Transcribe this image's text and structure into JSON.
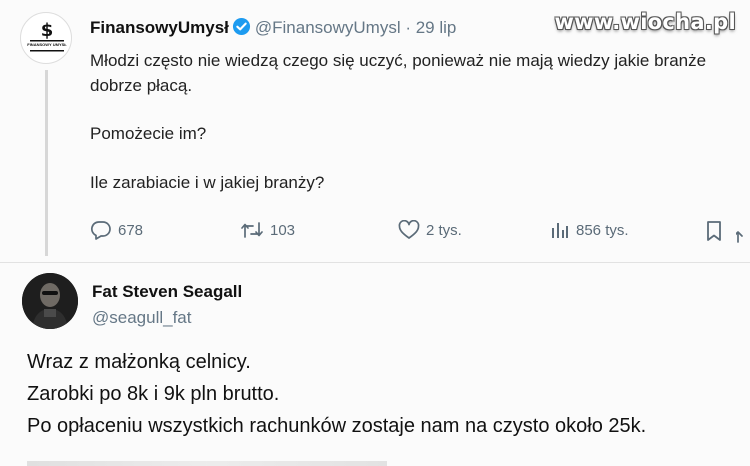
{
  "watermark": "www.wiocha.pl",
  "tweet": {
    "author_name": "FinansowyUmysł",
    "handle": "@FinansowyUmysl",
    "date": "· 29 lip",
    "avatar_text": "FINANSOWY UMYSŁ",
    "body": [
      "Młodzi często nie wiedzą czego się uczyć, ponieważ nie mają wiedzy jakie branże dobrze płacą.",
      "Pomożecie im?",
      "Ile zarabiacie i w jakiej branży?"
    ],
    "actions": {
      "replies": "678",
      "retweets": "103",
      "likes": "2 tys.",
      "views": "856 tys."
    },
    "colors": {
      "verified": "#1d9bf0",
      "muted": "#657786"
    }
  },
  "reply": {
    "author_name": "Fat Steven Seagall",
    "handle": "@seagull_fat",
    "body": [
      "Wraz z małżonką celnicy.",
      "Zarobki po 8k i 9k pln brutto.",
      "Po opłaceniu wszystkich rachunków zostaje nam na czysto około 25k."
    ]
  }
}
